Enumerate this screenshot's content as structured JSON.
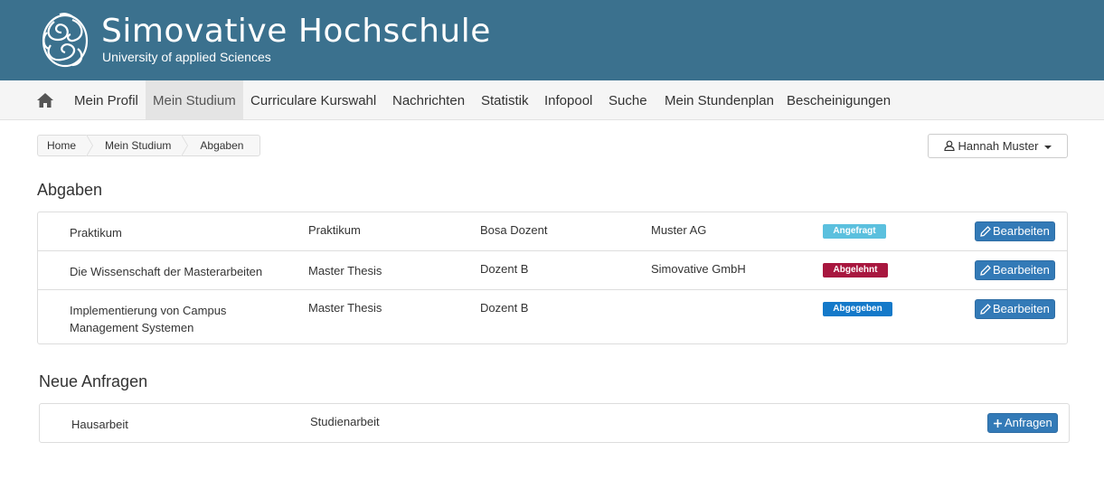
{
  "header": {
    "title": "Simovative  Hochschule",
    "subtitle": "University of applied Sciences"
  },
  "nav": {
    "home_icon": "home-icon",
    "items": [
      {
        "label": "Mein Profil"
      },
      {
        "label": "Mein Studium",
        "active": true
      },
      {
        "label": "Curriculare Kurswahl"
      },
      {
        "label": "Nachrichten"
      },
      {
        "label": "Statistik"
      },
      {
        "label": "Infopool"
      },
      {
        "label": "Suche"
      },
      {
        "label": "Mein Stundenplan"
      },
      {
        "label": "Bescheinigungen"
      }
    ]
  },
  "breadcrumb": [
    "Home",
    "Mein Studium",
    "Abgaben"
  ],
  "user_menu": {
    "label": "Hannah Muster",
    "icon": "user-icon"
  },
  "abgaben": {
    "title": "Abgaben",
    "rows": [
      {
        "title": "Praktikum",
        "type": "Praktikum",
        "lecturer": "Bosa Dozent",
        "company": "Muster AG",
        "status": "Angefragt",
        "status_color": "#5bc0de",
        "action": "Bearbeiten"
      },
      {
        "title": "Die Wissenschaft der Masterarbeiten",
        "type": "Master Thesis",
        "lecturer": "Dozent B",
        "company": "Simovative GmbH",
        "status": "Abgelehnt",
        "status_color": "#a8173f",
        "action": "Bearbeiten"
      },
      {
        "title": "Implementierung von Campus Management Systemen",
        "type": "Master Thesis",
        "lecturer": "Dozent B",
        "company": "",
        "status": "Abgegeben",
        "status_color": "#1479c9",
        "action": "Bearbeiten"
      }
    ]
  },
  "anfragen": {
    "title": "Neue Anfragen",
    "rows": [
      {
        "title": "Hausarbeit",
        "type": "Studienarbeit",
        "action": "Anfragen"
      }
    ]
  },
  "colors": {
    "header_bg": "#3b718e",
    "primary": "#337ab7"
  }
}
